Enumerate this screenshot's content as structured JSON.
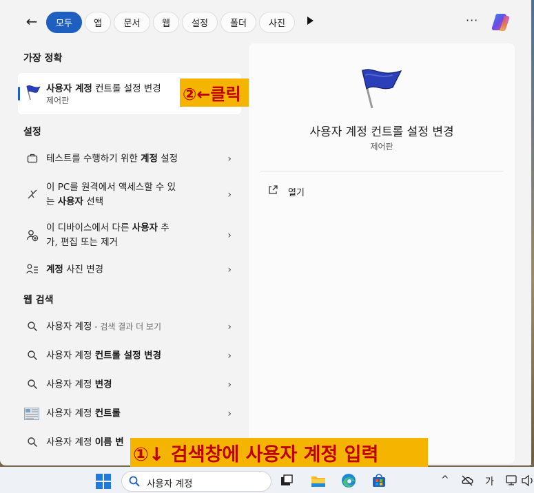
{
  "filters": {
    "back_icon": "arrow-left-icon",
    "chips": [
      "모두",
      "앱",
      "문서",
      "웹",
      "설정",
      "폴더",
      "사진"
    ],
    "active_chip": "모두",
    "more_label": "···"
  },
  "best_match": {
    "section_title": "가장 정확",
    "title_bold": "사용자 계정",
    "title_rest": " 컨트롤 설정 변경",
    "subtitle": "제어판",
    "icon": "flag-icon"
  },
  "callout_2": "②←클릭",
  "settings": {
    "section_title": "설정",
    "items": [
      {
        "icon": "briefcase-icon",
        "pre": "테스트를 수행하기 위한 ",
        "bold": "계정",
        "post": " 설정",
        "pre2": "",
        "bold2": "",
        "post2": ""
      },
      {
        "icon": "remote-icon",
        "pre": "이 PC를 원격에서 액세스할 수 있",
        "bold": "",
        "post": "",
        "pre2": "는 ",
        "bold2": "사용자",
        "post2": " 선택"
      },
      {
        "icon": "add-user-icon",
        "pre": "이 디바이스에서 다른 ",
        "bold": "사용자",
        "post": " 추",
        "pre2": "가, 편집 또는 제거",
        "bold2": "",
        "post2": ""
      },
      {
        "icon": "account-picture-icon",
        "pre": "",
        "bold": "계정",
        "post": " 사진 변경",
        "pre2": "",
        "bold2": "",
        "post2": ""
      }
    ]
  },
  "web": {
    "section_title": "웹 검색",
    "items": [
      {
        "icon": "search-icon",
        "pre": "사용자 계정",
        "bold": "",
        "dim": " - 검색 결과 더 보기"
      },
      {
        "icon": "search-icon",
        "pre": "사용자 계정 ",
        "bold": "컨트롤 설정 변경",
        "dim": ""
      },
      {
        "icon": "search-icon",
        "pre": "사용자 계정 ",
        "bold": "변경",
        "dim": ""
      },
      {
        "icon": "thumbnail-icon",
        "pre": "사용자 계정 ",
        "bold": "컨트롤",
        "dim": ""
      },
      {
        "icon": "search-icon",
        "pre": "사용자 계정 ",
        "bold": "이름 변",
        "dim": ""
      }
    ]
  },
  "detail": {
    "title": "사용자 계정 컨트롤 설정 변경",
    "subtitle": "제어판",
    "open_label": "열기"
  },
  "callout_1": "①↓ 검색창에 사용자 계정 입력",
  "taskbar": {
    "search_text": "사용자 계정",
    "tray": {
      "ime": "가",
      "chevron": "^"
    }
  },
  "colors": {
    "accent": "#1f5fbf",
    "callout_bg": "#f4b400",
    "callout_text": "#c00000"
  }
}
